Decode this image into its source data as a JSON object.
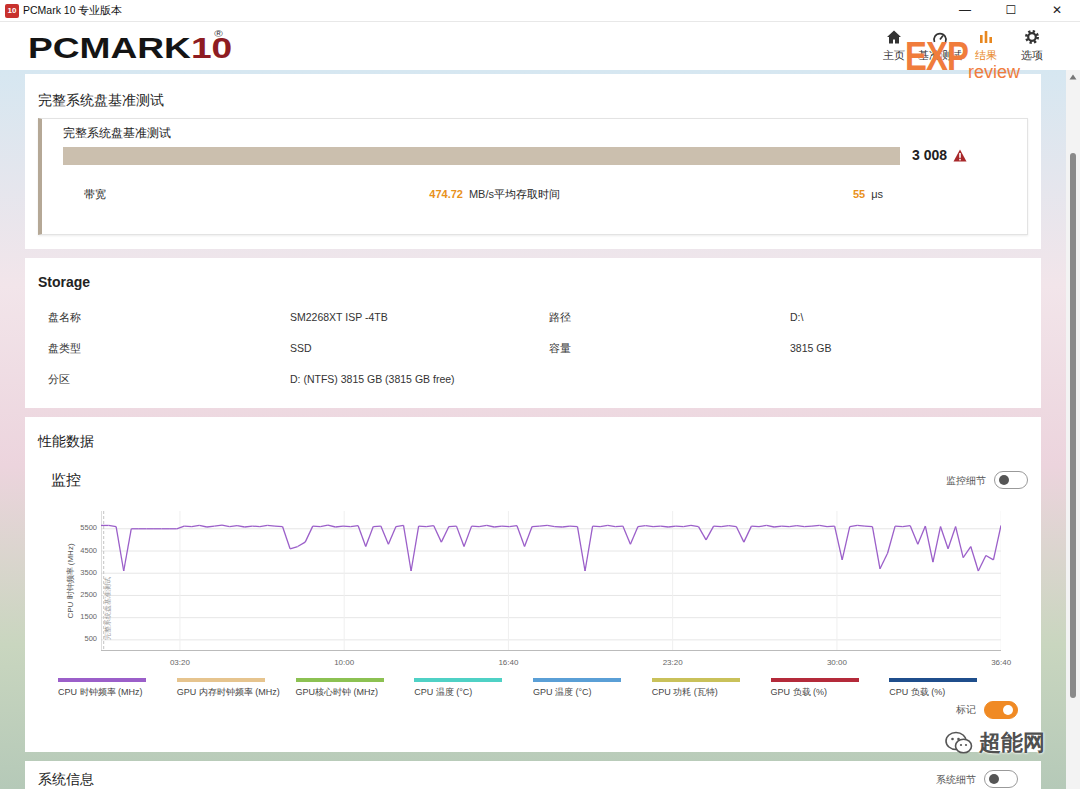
{
  "window": {
    "title": "PCMark 10 专业版本",
    "icon": "10",
    "controls": [
      "—",
      "☐",
      "✕"
    ]
  },
  "header": {
    "logo": "PCMARK",
    "logo_number": "10",
    "logo_reg": "®",
    "nav": [
      {
        "label": "主页",
        "selected": false
      },
      {
        "label": "基准测试",
        "selected": false
      },
      {
        "label": "结果",
        "selected": true
      },
      {
        "label": "选项",
        "selected": false
      }
    ],
    "watermark": {
      "big": "EXP",
      "small": "review"
    }
  },
  "result": {
    "section_title": "完整系统盘基准测试",
    "test_name": "完整系统盘基准测试",
    "score": "3 008",
    "warning": true,
    "level": 1,
    "metrics": [
      {
        "label": "带宽",
        "value": "474.72",
        "unit": "MB/s"
      },
      {
        "label": "平均存取时间",
        "value": "55",
        "unit": "μs"
      }
    ]
  },
  "storage": {
    "title": "Storage",
    "rows": [
      [
        {
          "label": "盘名称",
          "value": "SM2268XT ISP -4TB"
        },
        {
          "label": "路径",
          "value": "D:\\"
        }
      ],
      [
        {
          "label": "盘类型",
          "value": "SSD"
        },
        {
          "label": "容量",
          "value": "3815 GB"
        }
      ],
      [
        {
          "label": "分区",
          "value": "D: (NTFS) 3815 GB (3815 GB free)"
        }
      ]
    ]
  },
  "performance": {
    "title": "性能数据",
    "monitor_title": "监控",
    "details_toggle": {
      "label": "监控细节",
      "on": false
    },
    "chart": {
      "y_label": "CPU 时钟频率 (MHz)",
      "y_ticks": [
        "5500",
        "4500",
        "3500",
        "2500",
        "1500",
        "500"
      ],
      "x_ticks": [
        "03:20",
        "10:00",
        "16:40",
        "23:20",
        "30:00",
        "36:40"
      ],
      "marker": "完整系统盘基准测试",
      "series": [
        {
          "legend": 0,
          "values": [
            5650,
            5650,
            5600,
            3600,
            5500,
            5500,
            5500,
            5500,
            5500,
            5500,
            5500,
            5620,
            5600,
            5650,
            5580,
            5620,
            5660,
            5600,
            5640,
            5580,
            5620,
            5600,
            5650,
            5620,
            5600,
            4600,
            4700,
            4900,
            5620,
            5600,
            5660,
            5580,
            5620,
            5600,
            5640,
            4700,
            5600,
            5620,
            4800,
            5600,
            5650,
            3600,
            5620,
            5600,
            5640,
            4900,
            5600,
            5620,
            4700,
            5620,
            5600,
            5650,
            5580,
            5620,
            5600,
            5640,
            4700,
            5600,
            5620,
            5650,
            5600,
            5580,
            5620,
            5600,
            3600,
            5620,
            5600,
            5650,
            5600,
            5620,
            4800,
            5600,
            5640,
            5600,
            5620,
            5580,
            5620,
            5600,
            5650,
            5600,
            5000,
            5620,
            5600,
            5640,
            5600,
            4900,
            5620,
            5600,
            5650,
            5580,
            5620,
            5600,
            5640,
            5600,
            5620,
            5650,
            5600,
            5620,
            4100,
            5600,
            5650,
            5620,
            5600,
            3700,
            4400,
            5620,
            5600,
            5640,
            4800,
            5620,
            4000,
            5600,
            4600,
            5600,
            4200,
            4700,
            3600,
            4300,
            4100,
            5650
          ]
        }
      ],
      "legend": [
        {
          "label": "CPU 时钟频率 (MHz)",
          "color": "#9b5fc9"
        },
        {
          "label": "GPU 内存时钟频率 (MHz)",
          "color": "#e6c48e"
        },
        {
          "label": "GPU核心时钟 (MHz)",
          "color": "#8cc152"
        },
        {
          "label": "CPU 温度 (°C)",
          "color": "#4fd1c5"
        },
        {
          "label": "GPU 温度 (°C)",
          "color": "#5a9fd6"
        },
        {
          "label": "CPU 功耗 (瓦特)",
          "color": "#c9c15a"
        },
        {
          "label": "GPU 负载 (%)",
          "color": "#b42a3a"
        },
        {
          "label": "CPU 负载 (%)",
          "color": "#1f4e8c"
        }
      ]
    },
    "markers_toggle": {
      "label": "标记",
      "on": true
    }
  },
  "system_info": {
    "title": "系统信息",
    "details_toggle": {
      "label": "系统细节",
      "on": false
    }
  },
  "watermark": {
    "text": "超能网"
  }
}
